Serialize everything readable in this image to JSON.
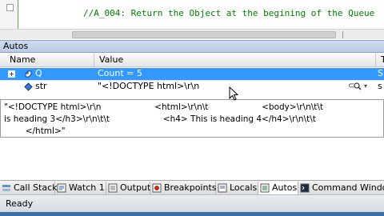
{
  "editor": {
    "comment": "//A_004: Return the Object at the begining of the Queue"
  },
  "autos": {
    "title": "Autos",
    "columns": {
      "name": "Name",
      "value": "Value",
      "type": "T"
    },
    "rows": [
      {
        "name": "Q",
        "value": "Count = 5",
        "type": "S",
        "selected": true,
        "expandable": true
      },
      {
        "name": "str",
        "value": "\"<!DOCTYPE html>\\r\\n",
        "type": "s",
        "selected": false,
        "expandable": false
      }
    ],
    "magnifier_label": "🔍"
  },
  "visualizer": {
    "line1": "\"<!DOCTYPE html>\\r\\n                    <html>\\r\\n\\t                    <body>\\r\\n\\t\\t",
    "line2": "is heading 3</h3>\\r\\n\\t\\t                    <h4> This is heading 4</h4>\\r\\n\\t\\t",
    "line3": "        </html>\""
  },
  "tabs": [
    {
      "label": "Call Stack",
      "icon": "call-stack-icon",
      "active": false
    },
    {
      "label": "Watch 1",
      "icon": "watch-icon",
      "active": false
    },
    {
      "label": "Output",
      "icon": "output-icon",
      "active": false
    },
    {
      "label": "Breakpoints",
      "icon": "breakpoints-icon",
      "active": false
    },
    {
      "label": "Locals",
      "icon": "locals-icon",
      "active": false
    },
    {
      "label": "Autos",
      "icon": "autos-icon",
      "active": true
    },
    {
      "label": "Command Windo",
      "icon": "command-window-icon",
      "active": false
    }
  ],
  "status": {
    "text": "Ready"
  },
  "colors": {
    "comment": "#008000",
    "selection": "#3399ff",
    "title_bar": "#c4d4ea"
  }
}
